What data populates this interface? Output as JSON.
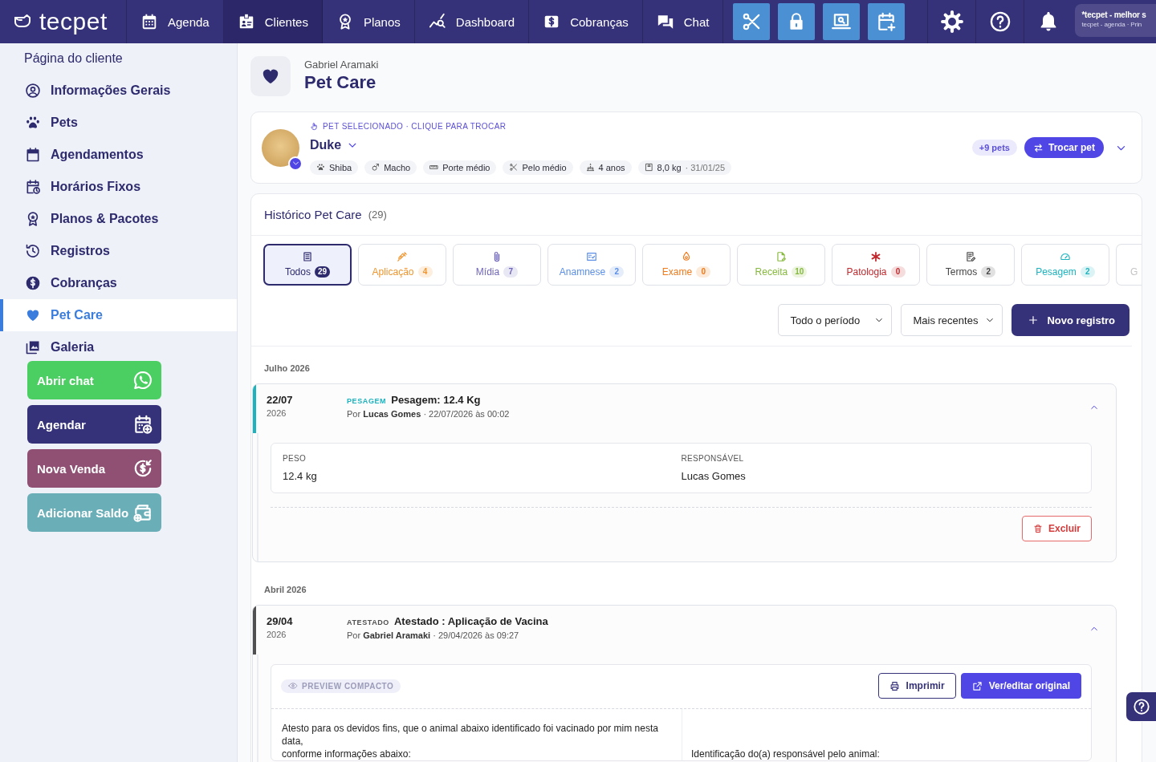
{
  "top_bar": {
    "logo": "tecpet",
    "nav": [
      {
        "label": "Agenda",
        "selected": false
      },
      {
        "label": "Clientes",
        "selected": true
      },
      {
        "label": "Planos",
        "selected": false
      },
      {
        "label": "Dashboard",
        "selected": false
      },
      {
        "label": "Cobranças",
        "selected": false
      },
      {
        "label": "Chat",
        "selected": false
      }
    ],
    "account": {
      "title": "*tecpet - melhor s",
      "subtitle": "tecpet - agenda · Prin"
    }
  },
  "sidebar": {
    "title": "Página do cliente",
    "items": [
      {
        "label": "Informações Gerais",
        "selected": false
      },
      {
        "label": "Pets",
        "selected": false
      },
      {
        "label": "Agendamentos",
        "selected": false
      },
      {
        "label": "Horários Fixos",
        "selected": false
      },
      {
        "label": "Planos & Pacotes",
        "selected": false
      },
      {
        "label": "Registros",
        "selected": false
      },
      {
        "label": "Cobranças",
        "selected": false
      },
      {
        "label": "Pet Care",
        "selected": true
      },
      {
        "label": "Galeria",
        "selected": false
      }
    ],
    "actions": [
      {
        "label": "Abrir chat",
        "color": "#4ccf62"
      },
      {
        "label": "Agendar",
        "color": "#36327a"
      },
      {
        "label": "Nova Venda",
        "color": "#8f5073"
      },
      {
        "label": "Adicionar Saldo",
        "color": "#6aaeb8"
      }
    ]
  },
  "header": {
    "owner": "Gabriel Aramaki",
    "title": "Pet Care"
  },
  "pet": {
    "hint": "PET SELECIONADO · CLIQUE PARA TROCAR",
    "name": "Duke",
    "chips": [
      {
        "label": "Shiba"
      },
      {
        "label": "Macho"
      },
      {
        "label": "Porte médio"
      },
      {
        "label": "Pelo médio"
      },
      {
        "label": "4 anos"
      },
      {
        "label": "8,0 kg",
        "note": "· 31/01/25"
      }
    ],
    "more_pets": "+9 pets",
    "switch_button": "Trocar pet"
  },
  "history": {
    "title": "Histórico Pet Care",
    "count": "(29)",
    "tabs": [
      {
        "label": "Todos",
        "count": "29",
        "selected": true,
        "color": "#2d2a6e"
      },
      {
        "label": "Aplicação",
        "count": "4",
        "selected": false,
        "color": "#f0952e"
      },
      {
        "label": "Mídia",
        "count": "7",
        "selected": false,
        "color": "#6f66b8"
      },
      {
        "label": "Anamnese",
        "count": "2",
        "selected": false,
        "color": "#5b8ee6"
      },
      {
        "label": "Exame",
        "count": "0",
        "selected": false,
        "color": "#ee7a1c"
      },
      {
        "label": "Receita",
        "count": "10",
        "selected": false,
        "color": "#86b93e"
      },
      {
        "label": "Patologia",
        "count": "0",
        "selected": false,
        "color": "#c0282d"
      },
      {
        "label": "Termos",
        "count": "2",
        "selected": false,
        "color": "#444444"
      },
      {
        "label": "Pesagem",
        "count": "2",
        "selected": false,
        "color": "#1bb3be"
      },
      {
        "label": "G",
        "selected": false,
        "color": "#c4c4c4"
      }
    ],
    "period": "Todo o período",
    "sort": "Mais recentes",
    "new_button": "Novo registro",
    "groups": [
      {
        "month": "Julho 2026",
        "records": [
          {
            "kind": "weight",
            "color": "#1bb3be",
            "day": "22/07",
            "year": "2026",
            "type": "PESAGEM",
            "title": "Pesagem: 12.4 Kg",
            "byline": "Por **Lucas Gomes** · 22/07/2026 às 00:02",
            "expanded": true,
            "fields": [
              {
                "label": "PESO",
                "value": "12.4 kg"
              },
              {
                "label": "RESPONSÁVEL",
                "value": "Lucas Gomes"
              }
            ],
            "delete_button": "Excluir"
          }
        ]
      },
      {
        "month": "Abril 2026",
        "records": [
          {
            "kind": "document",
            "color": "#505050",
            "day": "29/04",
            "year": "2026",
            "type": "ATESTADO",
            "title": "Atestado : Aplicação de Vacina",
            "byline": "Por **Gabriel Aramaki** · 29/04/2026 às 09:27",
            "expanded": true,
            "preview_badge": "PREVIEW COMPACTO",
            "print_button": "Imprimir",
            "edit_button": "Ver/editar original",
            "document": {
              "left": "Atesto para os devidos fins, que o animal abaixo identificado foi vacinado por mim nesta data,\nconforme informações abaixo:",
              "right": "Identificação do(a) responsável pelo animal:"
            }
          }
        ]
      }
    ]
  }
}
